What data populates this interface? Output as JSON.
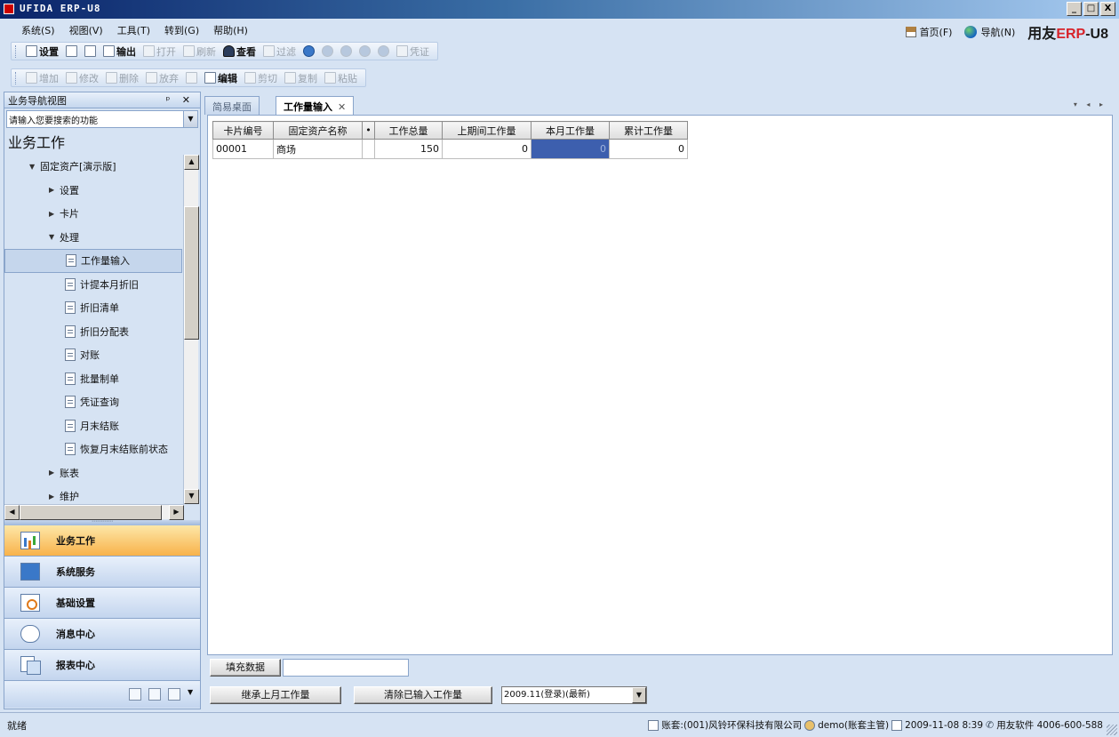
{
  "window": {
    "title": "UFIDA ERP-U8",
    "minimize": "_",
    "maximize": "□",
    "close": "X"
  },
  "menu": {
    "items": [
      "系统(S)",
      "视图(V)",
      "工具(T)",
      "转到(G)",
      "帮助(H)"
    ],
    "home": "首页(F)",
    "navigate": "导航(N)",
    "brand_prefix": "用友",
    "brand_erp": "ERP",
    "brand_suffix": "-U8"
  },
  "toolbar1": {
    "settings": "设置",
    "print": "",
    "preview": "",
    "output": "输出",
    "open": "打开",
    "refresh": "刷新",
    "view": "查看",
    "filter": "过滤",
    "help": "",
    "first": "",
    "prev": "",
    "next": "",
    "last": "",
    "voucher": "凭证"
  },
  "toolbar2": {
    "add": "增加",
    "modify": "修改",
    "delete": "删除",
    "abandon": "放弃",
    "save": "",
    "edit": "编辑",
    "cut": "剪切",
    "copy": "复制",
    "paste": "粘贴"
  },
  "nav": {
    "header": "业务导航视图",
    "header_controls": "ᵖ ✕",
    "search_placeholder": "请输入您要搜索的功能",
    "section_title": "业务工作",
    "tree": [
      {
        "label": "固定资产[演示版]",
        "level": 1,
        "expander": "▼"
      },
      {
        "label": "设置",
        "level": 2,
        "expander": "▶"
      },
      {
        "label": "卡片",
        "level": 2,
        "expander": "▶"
      },
      {
        "label": "处理",
        "level": 2,
        "expander": "▼"
      },
      {
        "label": "工作量输入",
        "level": 3,
        "selected": true
      },
      {
        "label": "计提本月折旧",
        "level": 3
      },
      {
        "label": "折旧清单",
        "level": 3
      },
      {
        "label": "折旧分配表",
        "level": 3
      },
      {
        "label": "对账",
        "level": 3
      },
      {
        "label": "批量制单",
        "level": 3
      },
      {
        "label": "凭证查询",
        "level": 3
      },
      {
        "label": "月末结账",
        "level": 3
      },
      {
        "label": "恢复月末结账前状态",
        "level": 3
      },
      {
        "label": "账表",
        "level": 2,
        "expander": "▶"
      },
      {
        "label": "维护",
        "level": 2,
        "expander": "▶"
      }
    ],
    "modules": [
      "业务工作",
      "系统服务",
      "基础设置",
      "消息中心",
      "报表中心"
    ],
    "active_module": "业务工作"
  },
  "tabs": [
    {
      "label": "简易桌面",
      "active": false
    },
    {
      "label": "工作量输入",
      "active": true,
      "close": "✕"
    }
  ],
  "tab_scroll": "▾ ◂ ▸",
  "grid": {
    "columns": [
      "卡片编号",
      "固定资产名称",
      "•",
      "工作总量",
      "上期间工作量",
      "本月工作量",
      "累计工作量"
    ],
    "rows": [
      [
        "00001",
        "商场",
        "",
        "150",
        "0",
        "0",
        "0"
      ]
    ]
  },
  "bottom": {
    "fill_button": "填充数据",
    "fill_value": "",
    "inherit_button": "继承上月工作量",
    "clear_button": "清除已输入工作量",
    "period": "2009.11(登录)(最新)"
  },
  "status": {
    "ready": "就绪",
    "account": "账套:(001)风铃环保科技有限公司",
    "user": "demo(账套主管)",
    "datetime": "2009-11-08 8:39",
    "hotline": "用友软件 4006-600-588"
  },
  "colors": {
    "accent": "#d8232a",
    "active_module": "#f8b24a",
    "selection": "#3d5fae",
    "chrome": "#d6e3f3"
  }
}
